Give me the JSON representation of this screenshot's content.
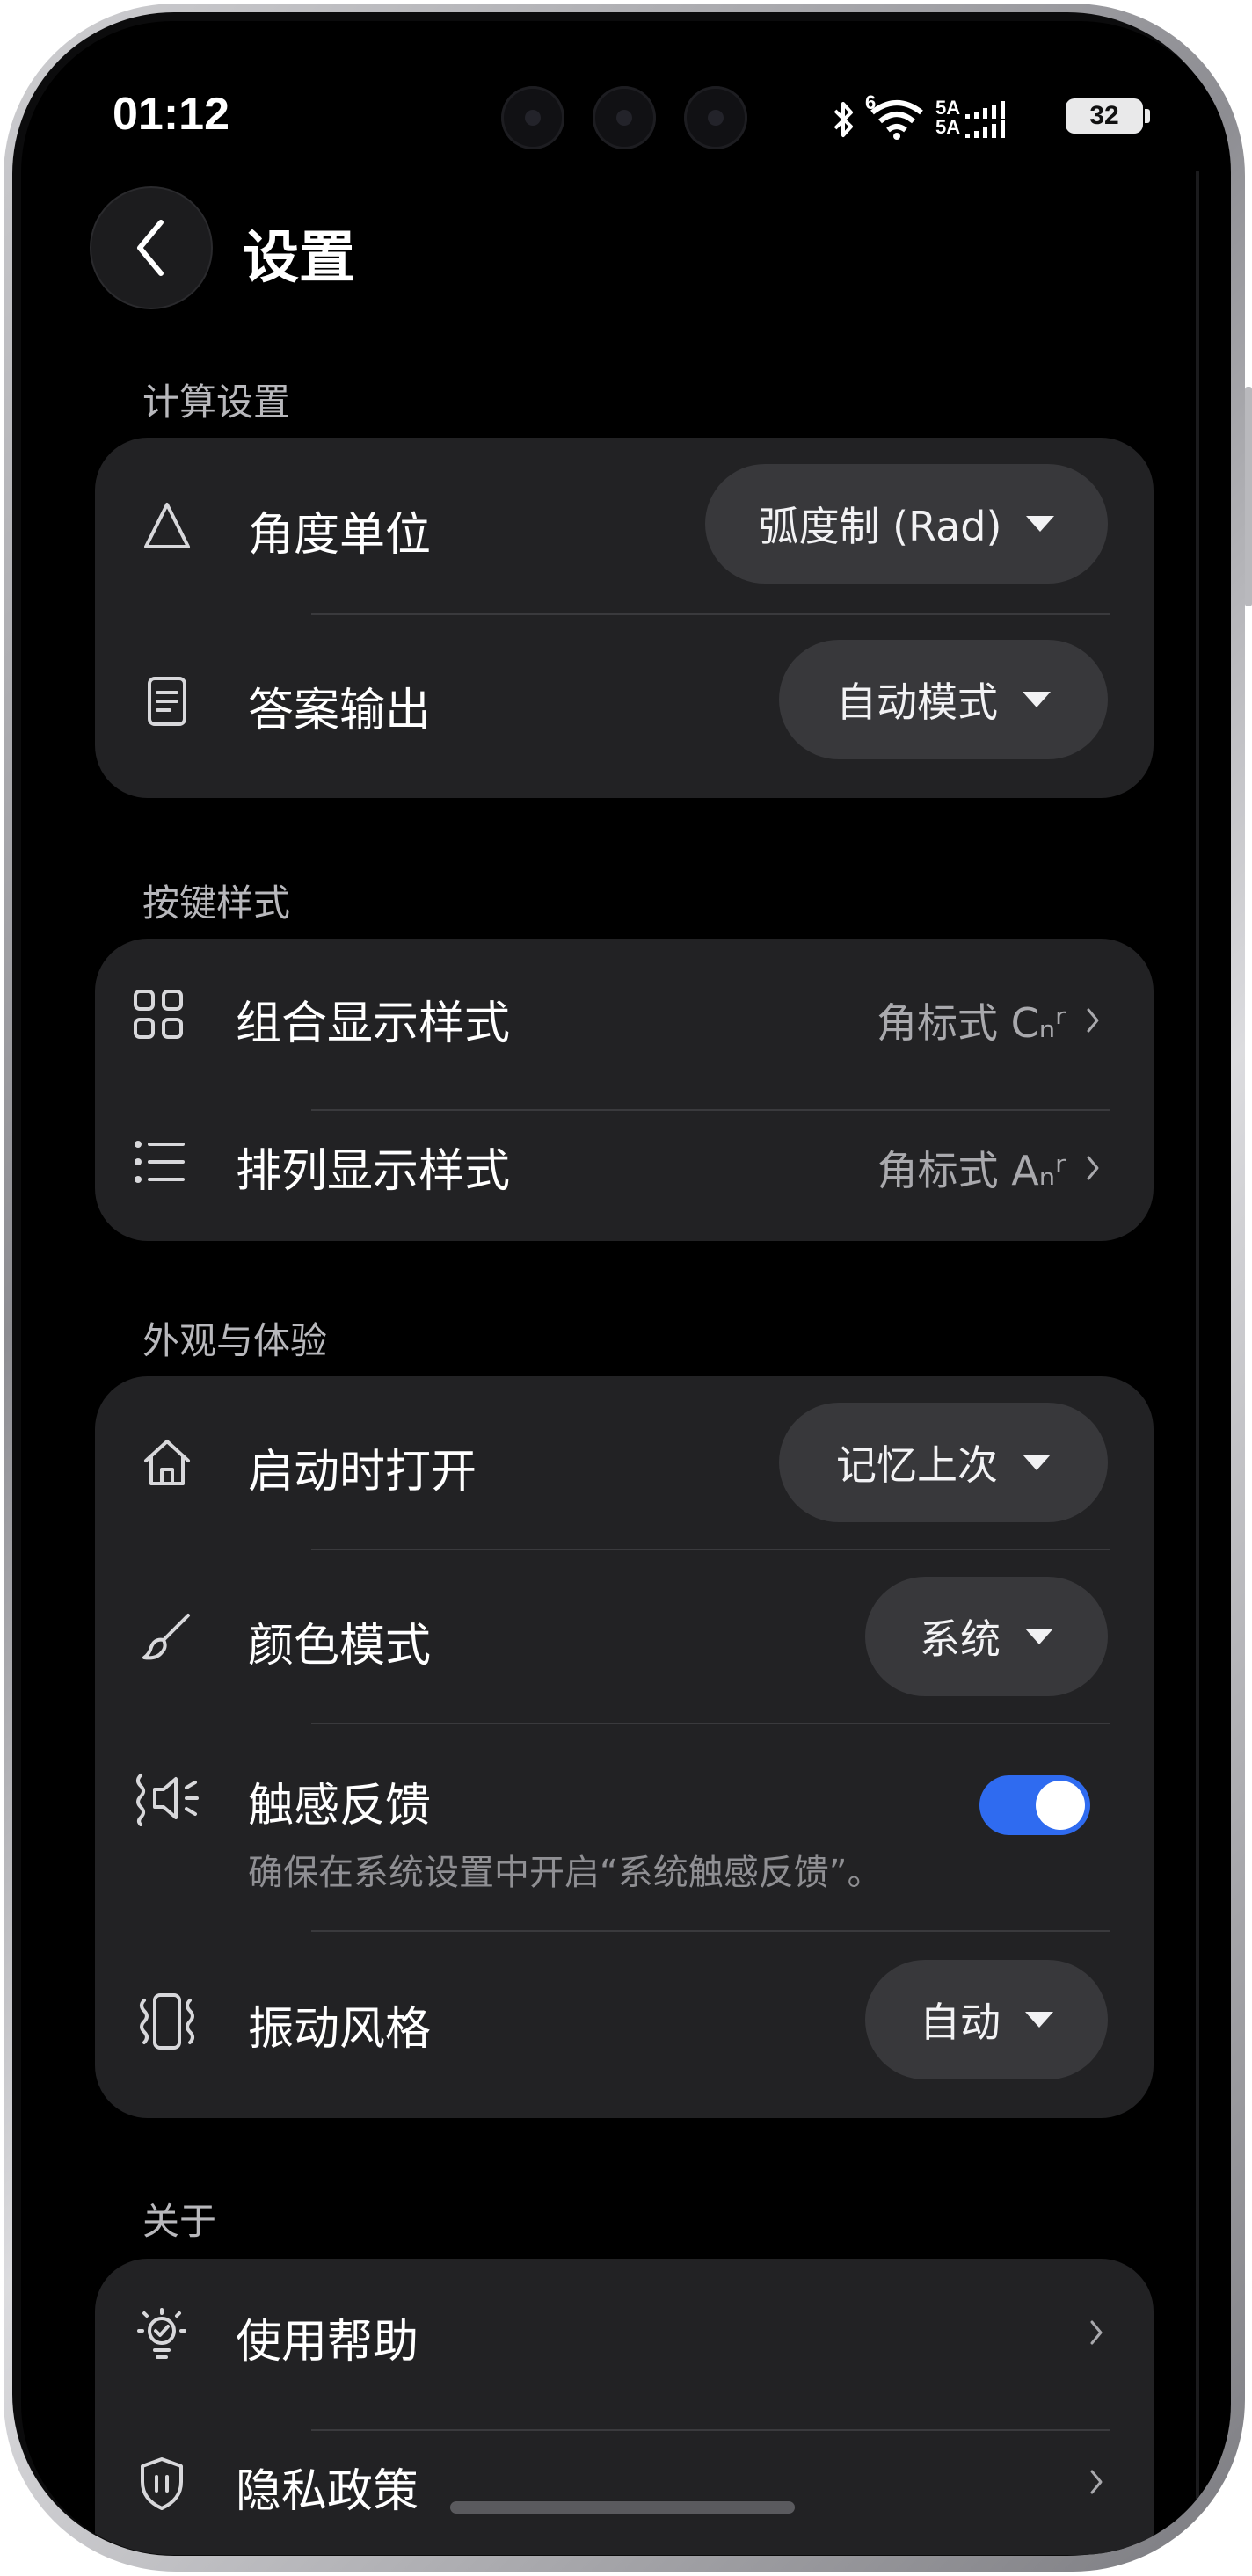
{
  "status_bar": {
    "time": "01:12",
    "network_top": "5A",
    "network_bottom": "5A",
    "signal_badge": "6",
    "battery": "32"
  },
  "header": {
    "title": "设置"
  },
  "sections": {
    "calc": {
      "label": "计算设置",
      "angle_unit": {
        "label": "角度单位",
        "value": "弧度制 (Rad)"
      },
      "answer_output": {
        "label": "答案输出",
        "value": "自动模式"
      }
    },
    "keys": {
      "label": "按键样式",
      "combination": {
        "label": "组合显示样式",
        "value": "角标式 Cₙʳ"
      },
      "permutation": {
        "label": "排列显示样式",
        "value": "角标式 Aₙʳ"
      }
    },
    "appearance": {
      "label": "外观与体验",
      "launch": {
        "label": "启动时打开",
        "value": "记忆上次"
      },
      "color_mode": {
        "label": "颜色模式",
        "value": "系统"
      },
      "haptics": {
        "label": "触感反馈",
        "hint": "确保在系统设置中开启“系统触感反馈”。",
        "enabled": true
      },
      "vibration": {
        "label": "振动风格",
        "value": "自动"
      }
    },
    "about": {
      "label": "关于",
      "help": {
        "label": "使用帮助"
      },
      "privacy": {
        "label": "隐私政策"
      }
    }
  },
  "colors": {
    "background": "#000000",
    "card": "#222224",
    "pill": "#38383b",
    "accent": "#2f6bf0",
    "section_label": "#b8b8bc"
  },
  "icons": {
    "back": "chevron-left-icon",
    "angle": "triangle-icon",
    "answer": "document-icon",
    "combination": "grid-icon",
    "permutation": "list-icon",
    "launch": "home-icon",
    "color": "brush-icon",
    "haptics": "vibrate-speaker-icon",
    "vibration": "phone-vibrate-icon",
    "help": "lightbulb-check-icon",
    "privacy": "shield-icon"
  }
}
